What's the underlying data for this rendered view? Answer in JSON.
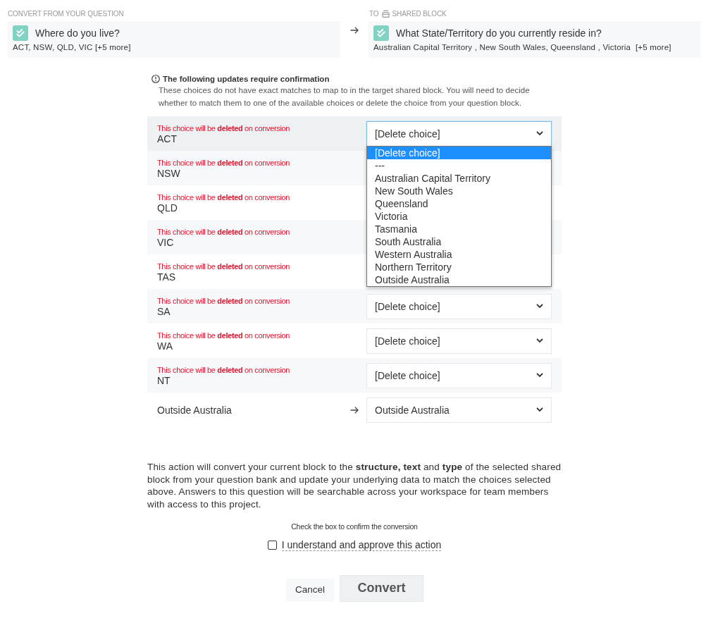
{
  "source": {
    "heading": "CONVERT FROM YOUR QUESTION",
    "question": "Where do you live?",
    "choices": "ACT, NSW, QLD, VIC [+5 more]"
  },
  "target": {
    "heading_prefix": "TO",
    "heading": "SHARED BLOCK",
    "question": "What State/Territory do you currently reside in?",
    "choices": "Australian Capital Territory , New South Wales, Queensland , Victoria  [+5 more]"
  },
  "confirmation": {
    "title": "The following updates require confirmation",
    "description": "These choices do not have exact matches to map to in the target shared block. You will need to decide whether to match them to one of the available choices or delete the choice from your question block."
  },
  "mappings": [
    {
      "kind": "deleted",
      "warning": "This choice will be **deleted** on conversion",
      "choice": "ACT",
      "value": "[Delete choice]",
      "open": true,
      "options": [
        {
          "label": "[Delete choice]",
          "selected": true
        },
        {
          "label": "---",
          "selected": false
        },
        {
          "label": "Australian Capital Territory",
          "selected": false
        },
        {
          "label": "New South Wales",
          "selected": false
        },
        {
          "label": "Queensland",
          "selected": false
        },
        {
          "label": "Victoria",
          "selected": false
        },
        {
          "label": "Tasmania",
          "selected": false
        },
        {
          "label": "South Australia",
          "selected": false
        },
        {
          "label": "Western Australia",
          "selected": false
        },
        {
          "label": "Northern Territory",
          "selected": false
        },
        {
          "label": "Outside Australia",
          "selected": false
        }
      ]
    },
    {
      "kind": "deleted",
      "warning": "This choice will be **deleted** on conversion",
      "choice": "NSW",
      "open": false
    },
    {
      "kind": "deleted",
      "warning": "This choice will be **deleted** on conversion",
      "choice": "QLD",
      "open": false
    },
    {
      "kind": "deleted",
      "warning": "This choice will be **deleted** on conversion",
      "choice": "VIC",
      "open": false
    },
    {
      "kind": "deleted",
      "warning": "This choice will be **deleted** on conversion",
      "choice": "TAS",
      "open": false
    },
    {
      "kind": "deleted",
      "warning": "This choice will be **deleted** on conversion",
      "choice": "SA",
      "value": "[Delete choice]",
      "open": false
    },
    {
      "kind": "deleted",
      "warning": "This choice will be **deleted** on conversion",
      "choice": "WA",
      "value": "[Delete choice]",
      "open": false
    },
    {
      "kind": "deleted",
      "warning": "This choice will be **deleted** on conversion",
      "choice": "NT",
      "value": "[Delete choice]",
      "open": false
    },
    {
      "kind": "matched",
      "choice": "Outside Australia",
      "value": "Outside Australia",
      "open": false
    }
  ],
  "notice": "This action will convert your current block to the **structure, text** and **type** of the selected shared block from your question bank and update your underlying data to match the choices selected above. Answers to this question will be searchable across your workspace for team members with access to this project.",
  "confirm_hint": "Check the box to confirm the conversion",
  "approve": {
    "label": "I understand and approve this action",
    "checked": false
  },
  "buttons": [
    {
      "label": "Cancel",
      "kind": "secondary"
    },
    {
      "label": "Convert",
      "kind": "primary"
    }
  ]
}
